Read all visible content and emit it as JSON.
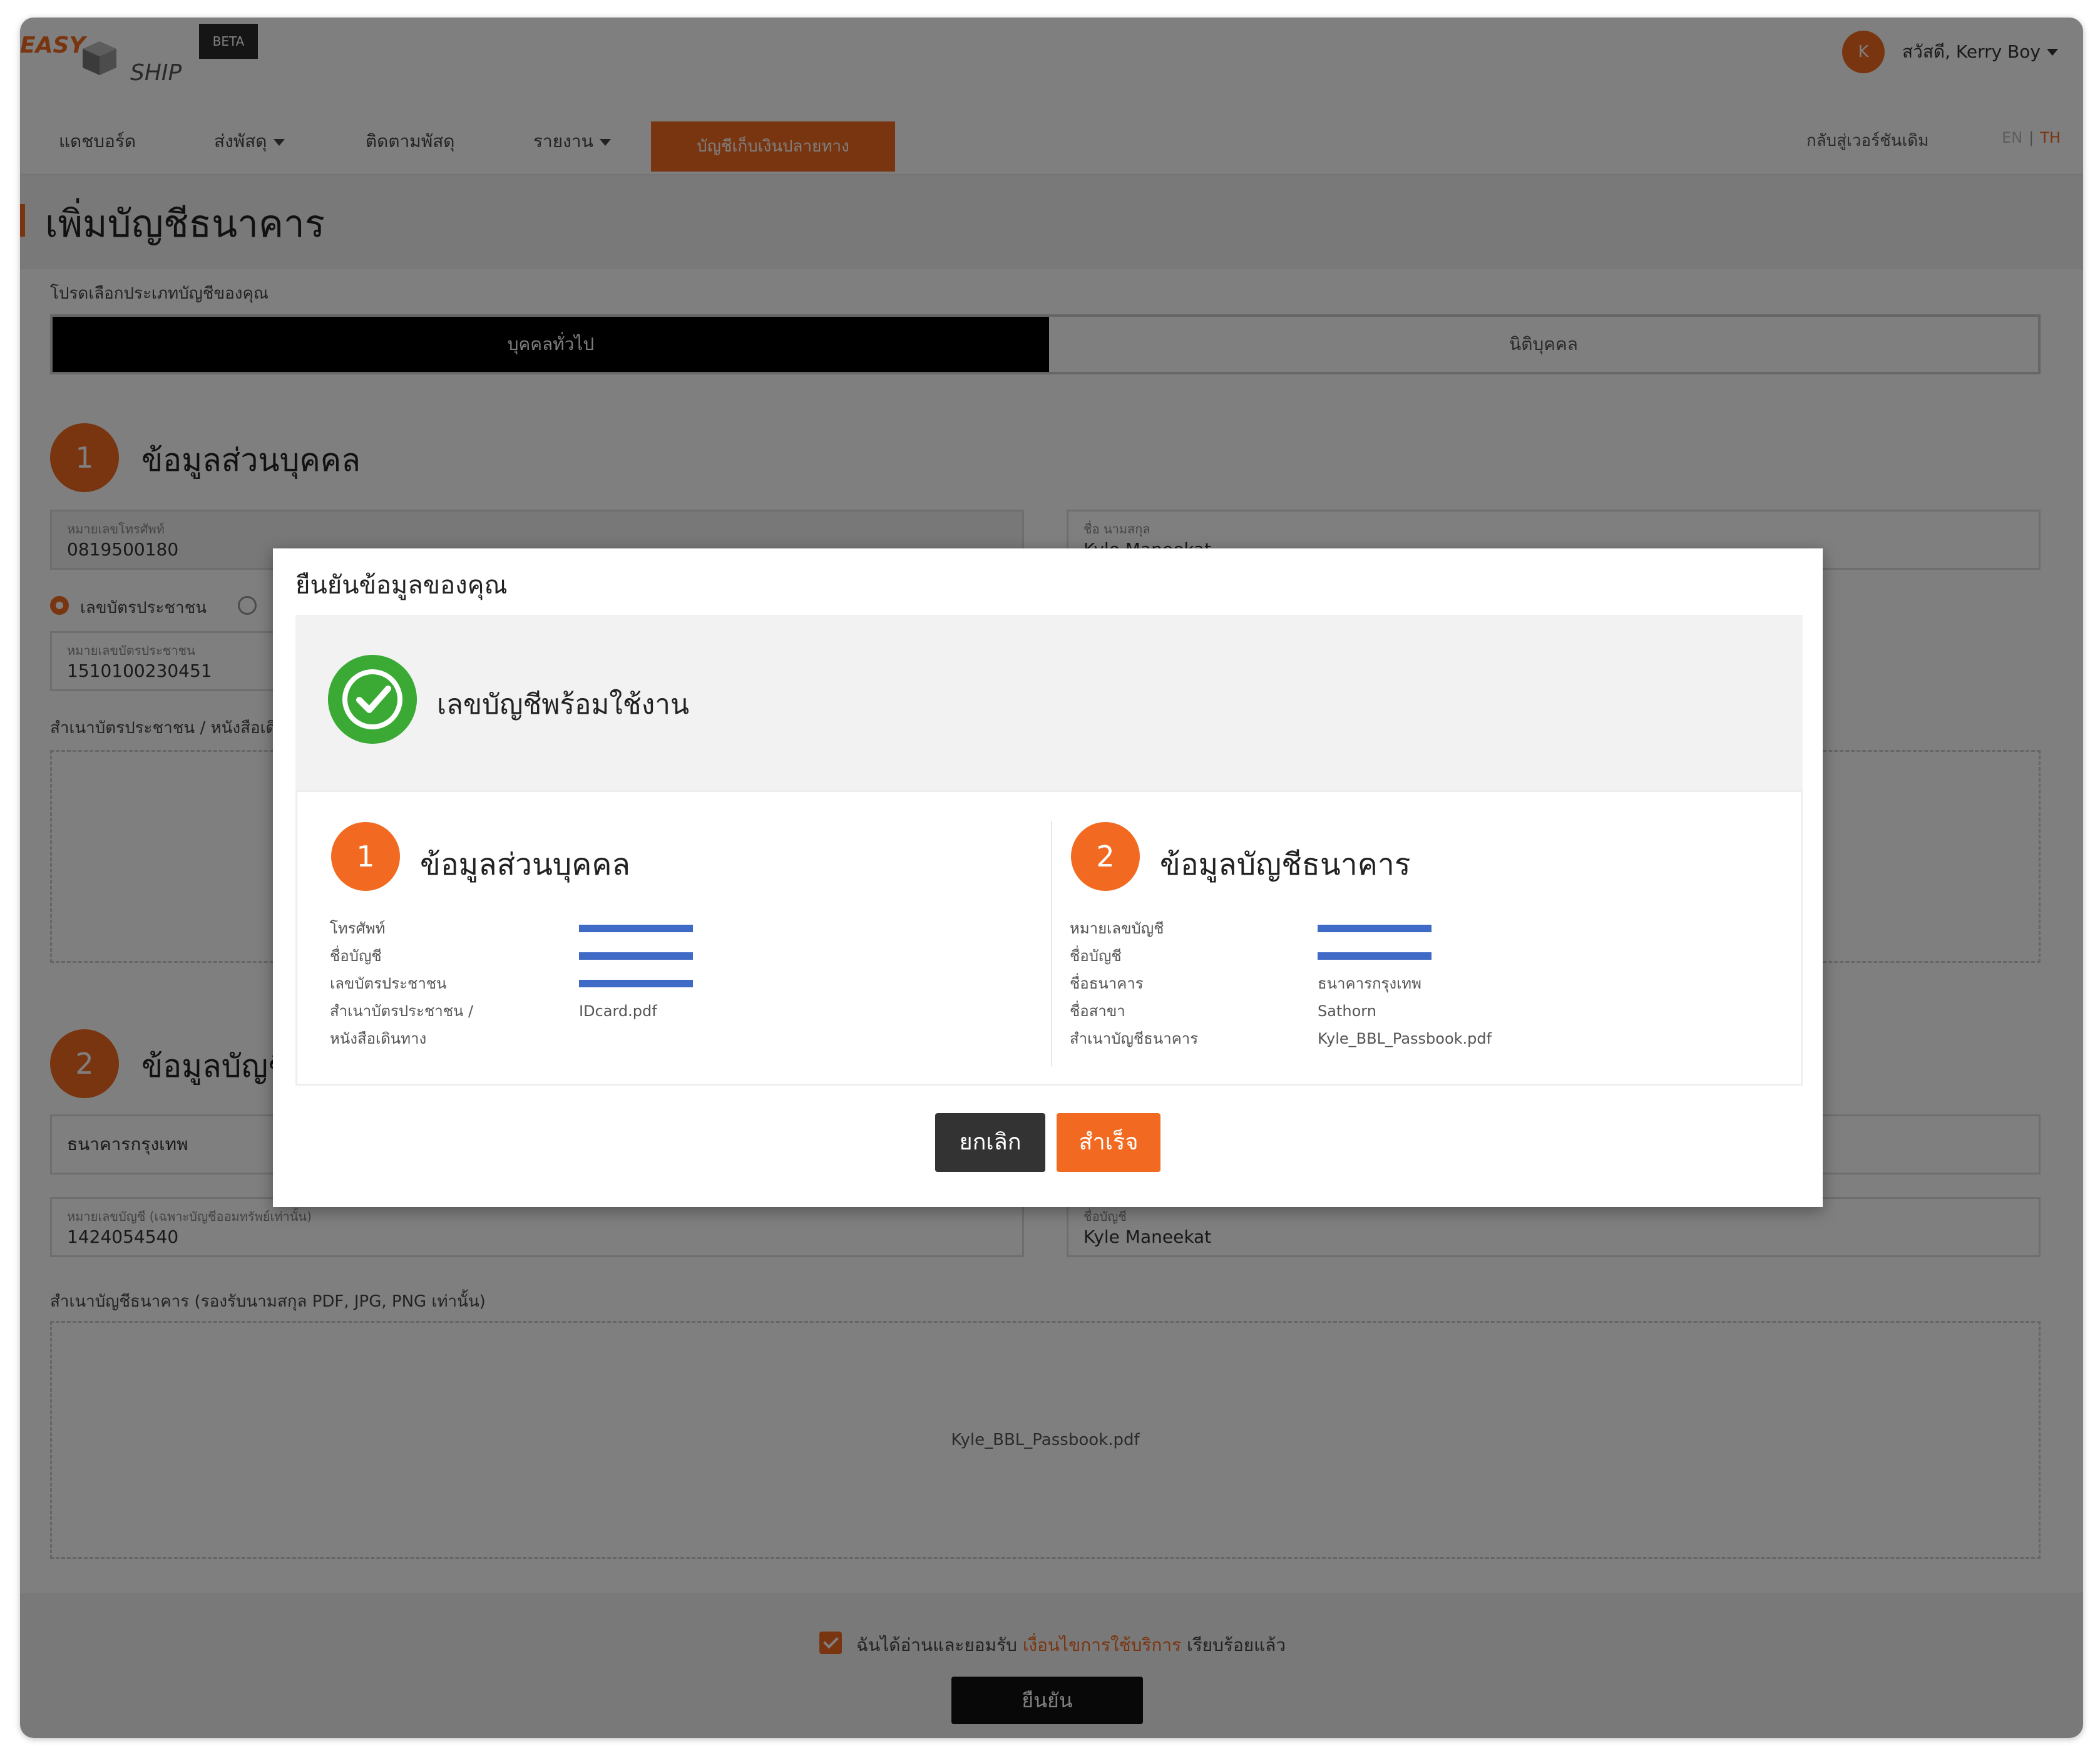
{
  "brand": {
    "logo_left": "EASY",
    "logo_right": "SHIP",
    "beta": "BETA"
  },
  "user": {
    "avatar_initial": "K",
    "name": "สวัสดี, Kerry Boy"
  },
  "nav": {
    "items": [
      "แดชบอร์ด",
      "ส่งพัสดุ",
      "ติดตามพัสดุ",
      "รายงาน"
    ],
    "active": "บัญชีเก็บเงินปลายทาง",
    "back_to_old": "กลับสู่เวอร์ชันเดิม",
    "lang_en": "EN",
    "lang_sep": "|",
    "lang_th": "TH"
  },
  "page": {
    "title": "เพิ่มบัญชีธนาคาร"
  },
  "form": {
    "account_type_label": "โปรดเลือกประเภทบัญชีของคุณ",
    "tab_individual": "บุคคลทั่วไป",
    "tab_corporate": "นิติบุคคล",
    "step1": {
      "num": "1",
      "title": "ข้อมูลส่วนบุคคล"
    },
    "phone": {
      "label": "หมายเลขโทรศัพท์",
      "value": "0819500180"
    },
    "fullname": {
      "label": "ชื่อ นามสกุล",
      "value": "Kyle Maneekat"
    },
    "radio_id_card": "เลขบัตรประชาชน",
    "id_number": {
      "label": "หมายเลขบัตรประชาชน",
      "value": "1510100230451"
    },
    "id_copy_label": "สำเนาบัตรประชาชน / หนังสือเดินทาง",
    "step2": {
      "num": "2",
      "title": "ข้อมูลบัญชีธนาคาร"
    },
    "bank": {
      "value": "ธนาคารกรุงเทพ"
    },
    "account_number": {
      "label": "หมายเลขบัญชี (เฉพาะบัญชีออมทรัพย์เท่านั้น)",
      "value": "1424054540"
    },
    "account_name": {
      "label": "ชื่อบัญชี",
      "value": "Kyle Maneekat"
    },
    "passbook_label": "สำเนาบัญชีธนาคาร (รองรับนามสกุล PDF, JPG, PNG เท่านั้น)",
    "passbook_file": "Kyle_BBL_Passbook.pdf"
  },
  "footer": {
    "terms_prefix": "ฉันได้อ่านและยอมรับ",
    "terms_link": "เงื่อนไขการใช้บริการ",
    "terms_suffix": "เรียบร้อยแล้ว",
    "confirm": "ยืนยัน"
  },
  "modal": {
    "title": "ยืนยันข้อมูลของคุณ",
    "success": "เลขบัญชีพร้อมใช้งาน",
    "personal": {
      "num": "1",
      "title": "ข้อมูลส่วนบุคคล",
      "rows": [
        {
          "label": "โทรศัพท์",
          "value": ""
        },
        {
          "label": "ชื่อบัญชี",
          "value": ""
        },
        {
          "label": "เลขบัตรประชาชน",
          "value": ""
        },
        {
          "label": "สำเนาบัตรประชาชน /",
          "value": "IDcard.pdf"
        },
        {
          "label": "หนังสือเดินทาง",
          "value": ""
        }
      ]
    },
    "bank_info": {
      "num": "2",
      "title": "ข้อมูลบัญชีธนาคาร",
      "rows": [
        {
          "label": "หมายเลขบัญชี",
          "value": ""
        },
        {
          "label": "ชื่อบัญชี",
          "value": ""
        },
        {
          "label": "ชื่อธนาคาร",
          "value": "ธนาคารกรุงเทพ"
        },
        {
          "label": "ชื่อสาขา",
          "value": "Sathorn"
        },
        {
          "label": "สำเนาบัญชีธนาคาร",
          "value": "Kyle_BBL_Passbook.pdf"
        }
      ]
    },
    "cancel": "ยกเลิก",
    "ok": "สำเร็จ"
  },
  "colors": {
    "accent": "#f26a21",
    "success": "#3aaa35",
    "redaction": "#3f6bc7",
    "dark": "#111111"
  }
}
